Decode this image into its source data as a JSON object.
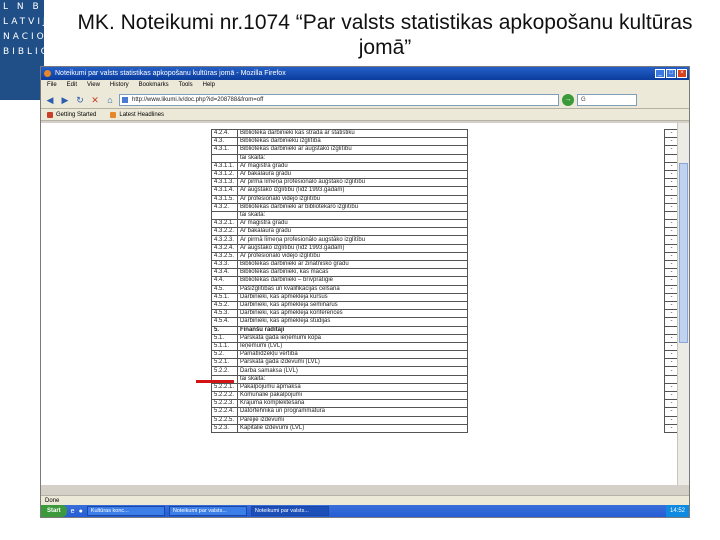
{
  "logo": {
    "rows": [
      "L N B",
      "LATVIJAS",
      "NACIONĀLĀ",
      "BIBLIO"
    ]
  },
  "slide_title": "MK. Noteikumi nr.1074 “Par valsts statistikas apkopošanu kultūras jomā”",
  "browser": {
    "window_title": "Noteikumi par valsts statistikas apkopošanu kultūras jomā - Mozilla Firefox",
    "menu": [
      "File",
      "Edit",
      "View",
      "History",
      "Bookmarks",
      "Tools",
      "Help"
    ],
    "url": "http://www.likumi.lv/doc.php?id=208788&from=off",
    "search_placeholder": "G",
    "bookmarks": [
      "Getting Started",
      "Latest Headlines"
    ],
    "status": "Done",
    "accent_title": "#0a3c9c",
    "marker_color": "#d21414"
  },
  "table_rows": [
    {
      "num": "4.2.4.",
      "text": "Bibliotēkā darbinieki kas strādā ar statistiku",
      "dash": "-"
    },
    {
      "num": "4.3.",
      "text": "Bibliotēkas darbinieku izglītība",
      "dash": "-"
    },
    {
      "num": "4.3.1.",
      "text": "Bibliotēkas darbinieki ar augstāko izglītību",
      "dash": "-"
    },
    {
      "num": "",
      "text": "tai skaitā:",
      "dash": ""
    },
    {
      "num": "4.3.1.1.",
      "text": "Ar maģistra grādu",
      "dash": "-"
    },
    {
      "num": "4.3.1.2.",
      "text": "Ar bakalaura grādu",
      "dash": "-"
    },
    {
      "num": "4.3.1.3.",
      "text": "Ar pirmā līmeņa profesionālo augstāko izglītību",
      "dash": "-"
    },
    {
      "num": "4.3.1.4.",
      "text": "Ar augstāko izglītību (līdz 1993.gadam)",
      "dash": "-"
    },
    {
      "num": "4.3.1.5.",
      "text": "Ar profesionālo vidējo izglītību",
      "dash": "-"
    },
    {
      "num": "4.3.2.",
      "text": "Bibliotēkas darbinieki ar bibliotekāro izglītību",
      "dash": "-"
    },
    {
      "num": "",
      "text": "tai skaitā:",
      "dash": ""
    },
    {
      "num": "4.3.2.1.",
      "text": "Ar maģistra grādu",
      "dash": "-"
    },
    {
      "num": "4.3.2.2.",
      "text": "Ar bakalaura grādu",
      "dash": "-"
    },
    {
      "num": "4.3.2.3.",
      "text": "Ar pirmā līmeņa profesionālo augstāko izglītību",
      "dash": "-"
    },
    {
      "num": "4.3.2.4.",
      "text": "Ar augstāko izglītību (līdz 1993.gadam)",
      "dash": "-"
    },
    {
      "num": "4.3.2.5.",
      "text": "Ar profesionālo vidējo izglītību",
      "dash": "-"
    },
    {
      "num": "4.3.3.",
      "text": "Bibliotēkas darbinieki ar zinātnisko grādu",
      "dash": "-"
    },
    {
      "num": "4.3.4.",
      "text": "Bibliotēkas darbinieki, kas mācās",
      "dash": "-"
    },
    {
      "num": "4.4.",
      "text": "Bibliotēkas darbinieki – brīvprātīgie",
      "dash": "-"
    },
    {
      "num": "4.5.",
      "text": "Pašizglītības un kvalifikācijas celšanā",
      "dash": "-"
    },
    {
      "num": "4.5.1.",
      "text": "Darbinieki, kas apmeklēja kursus",
      "dash": "-"
    },
    {
      "num": "4.5.2.",
      "text": "Darbinieki, kas apmeklēja seminārus",
      "dash": "-"
    },
    {
      "num": "4.5.3.",
      "text": "Darbinieki, kas apmeklēja konferences",
      "dash": "-"
    },
    {
      "num": "4.5.4.",
      "text": "Darbinieki, kas apmeklēja studijas",
      "dash": "-"
    },
    {
      "num": "5.",
      "text": "Finanšu rādītāji",
      "dash": "",
      "bold": true
    },
    {
      "num": "5.1.",
      "text": "Pārskata gada ieņēmumi kopā",
      "dash": "-"
    },
    {
      "num": "5.1.1.",
      "text": "Ieņēmumi (LVL)",
      "dash": "-"
    },
    {
      "num": "5.2.",
      "text": "Pamatlīdzekļu vērtība",
      "dash": "-"
    },
    {
      "num": "5.2.1.",
      "text": "Pārskata gada izdevumi (LVL)",
      "dash": "-"
    },
    {
      "num": "5.2.2.",
      "text": "Darba samaksa (LVL)",
      "dash": "-"
    },
    {
      "num": "",
      "text": "tai skaitā:",
      "dash": ""
    },
    {
      "num": "5.2.2.1.",
      "text": "Pakalpojumu apmaksa",
      "dash": "-"
    },
    {
      "num": "5.2.2.2.",
      "text": "Komunālie pakalpojumi",
      "dash": "-"
    },
    {
      "num": "5.2.2.3.",
      "text": "Krājuma komplektēšana",
      "dash": "-"
    },
    {
      "num": "5.2.2.4.",
      "text": "Datortehnika un programmatūra",
      "dash": "-"
    },
    {
      "num": "5.2.2.5.",
      "text": "Pārējie izdevumi",
      "dash": "-"
    },
    {
      "num": "5.2.3.",
      "text": "Kapitālie izdevumi (LVL)",
      "dash": "-"
    }
  ],
  "taskbar": {
    "start": "Start",
    "tasks": [
      {
        "label": "Kultūras konc...",
        "active": false
      },
      {
        "label": "Noteikumi par valsts...",
        "active": false
      },
      {
        "label": "Noteikumi par valsts...",
        "active": true
      }
    ],
    "tray_time": "14:52"
  }
}
